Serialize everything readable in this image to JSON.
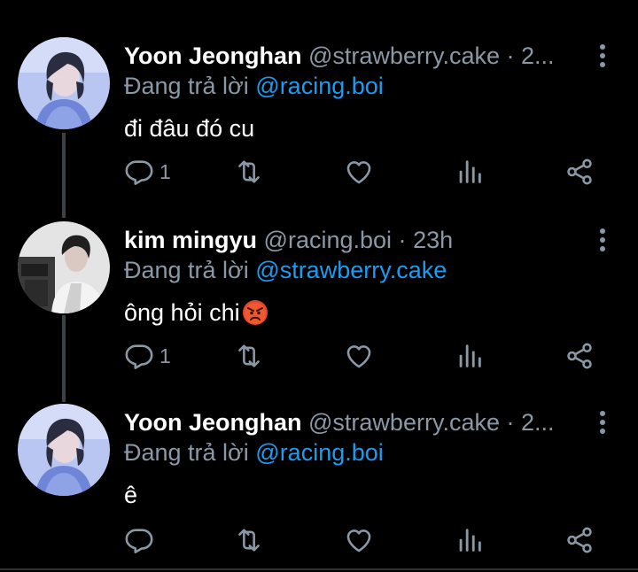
{
  "tweets": [
    {
      "name": "Yoon Jeonghan",
      "handle": "@strawberry.cake",
      "separator": "·",
      "time": "2...",
      "reply_prefix": "Đang trả lời",
      "reply_to": "@racing.boi",
      "text": "đi đâu đó cu",
      "reply_count": "1",
      "avatar_palette": "blue-lavender"
    },
    {
      "name": "kim mingyu",
      "handle": "@racing.boi",
      "separator": "·",
      "time": "23h",
      "reply_prefix": "Đang trả lời",
      "reply_to": "@strawberry.cake",
      "text": "ông hỏi chi",
      "emoji": "angry-face",
      "reply_count": "1",
      "avatar_palette": "grayscale"
    },
    {
      "name": "Yoon Jeonghan",
      "handle": "@strawberry.cake",
      "separator": "·",
      "time": "2...",
      "reply_prefix": "Đang trả lời",
      "reply_to": "@racing.boi",
      "text": "ê",
      "reply_count": "",
      "avatar_palette": "blue-lavender"
    }
  ],
  "icons": {
    "reply": "reply-icon",
    "retweet": "retweet-icon",
    "like": "heart-icon",
    "views": "views-icon",
    "share": "share-icon",
    "more": "more-vertical-icon"
  },
  "colors": {
    "background": "#000000",
    "primary_text": "#ffffff",
    "secondary_text": "#8b98a5",
    "link": "#1d9bf0",
    "thread_line": "#3e4144"
  }
}
